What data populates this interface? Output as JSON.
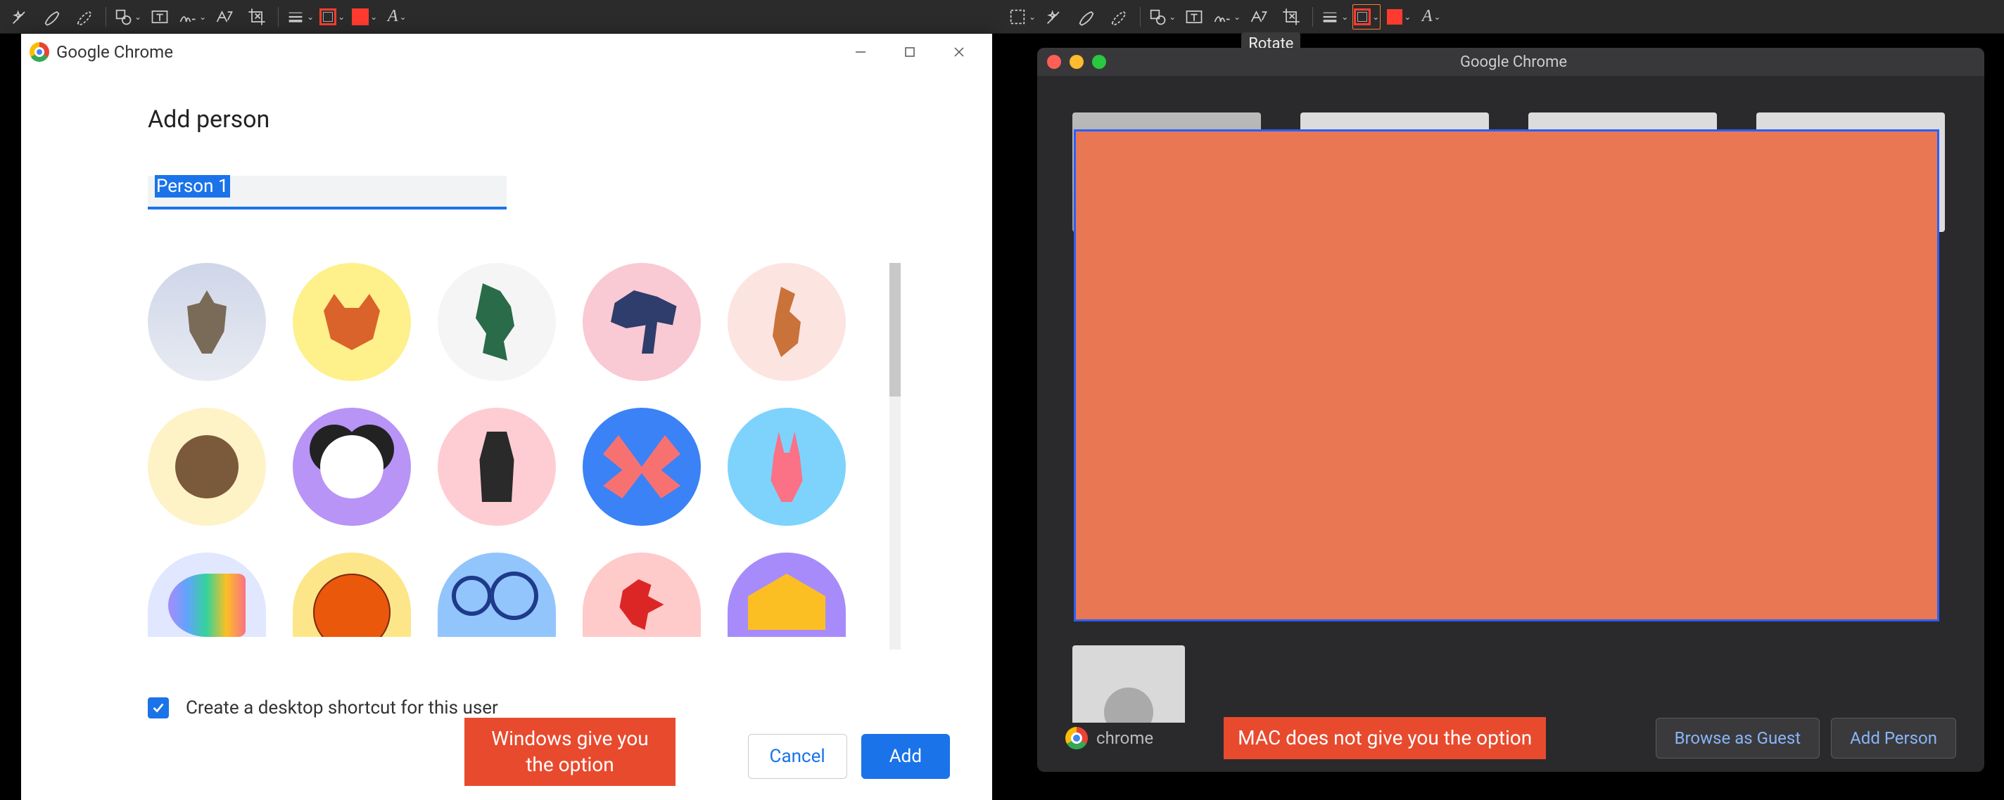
{
  "left": {
    "toolbar": {
      "icons": [
        "wand",
        "brush",
        "eraser",
        "shape",
        "text",
        "signature",
        "notes",
        "crop",
        "line-style",
        "border-swatch",
        "fill-swatch",
        "font"
      ]
    },
    "dialog": {
      "title": "Google Chrome",
      "heading": "Add person",
      "name_input_value": "Person 1",
      "avatars": [
        "origami-cat",
        "origami-fox",
        "origami-dragon",
        "origami-elephant",
        "origami-squirrel",
        "origami-monkey",
        "origami-panda",
        "origami-penguin",
        "origami-butterfly",
        "origami-rabbit",
        "origami-unicorn",
        "basketball",
        "bicycle",
        "origami-bird",
        "cheese"
      ],
      "checkbox_label": "Create a desktop shortcut for this user",
      "checkbox_checked": true,
      "cancel_label": "Cancel",
      "add_label": "Add"
    },
    "callout": "Windows give you the option"
  },
  "right": {
    "toolbar": {
      "icons": [
        "marquee",
        "wand",
        "brush",
        "eraser",
        "shape",
        "text",
        "signature",
        "notes",
        "crop",
        "line-style",
        "border-swatch",
        "fill-swatch",
        "font"
      ],
      "tooltip": "Rotate"
    },
    "dialog": {
      "title": "Google Chrome",
      "brand_label": "chrome",
      "browse_guest_label": "Browse as Guest",
      "add_person_label": "Add Person"
    },
    "callout": "MAC does not give you the option"
  },
  "colors": {
    "accent_blue": "#1a73e8",
    "callout_red": "#e84a2e",
    "orange_block": "#e97754",
    "swatch_red": "#ff3b30"
  }
}
